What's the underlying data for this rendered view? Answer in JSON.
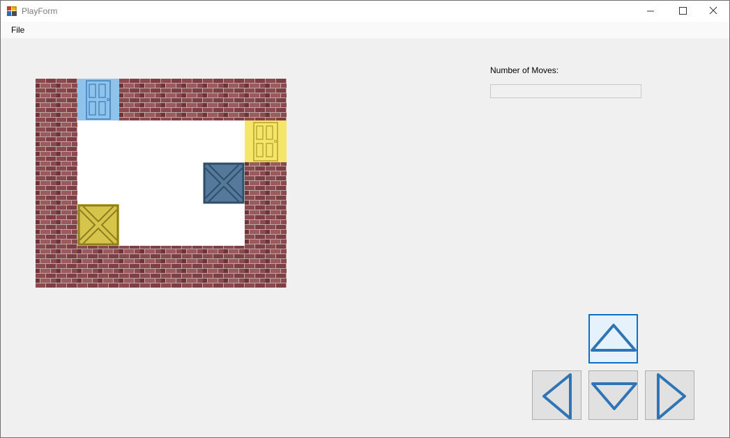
{
  "window": {
    "title": "PlayForm"
  },
  "menu": {
    "file_label": "File"
  },
  "moves": {
    "label": "Number of Moves:",
    "value": ""
  },
  "colors": {
    "brick": "#8b4a4d",
    "mortar": "#bfa9ab",
    "floor": "#ffffff",
    "blue": "#8fc3ec",
    "yellow": "#f5e66a",
    "arrow": "#2f74b5"
  },
  "board": {
    "rows": 5,
    "cols": 6,
    "grid": [
      [
        "wall",
        "door-blue",
        "wall",
        "wall",
        "wall",
        "wall"
      ],
      [
        "wall",
        "floor",
        "floor",
        "floor",
        "floor",
        "door-yellow"
      ],
      [
        "wall",
        "floor",
        "floor",
        "floor",
        "box-blue",
        "wall"
      ],
      [
        "wall",
        "box-yellow",
        "floor",
        "floor",
        "floor",
        "wall"
      ],
      [
        "wall",
        "wall",
        "wall",
        "wall",
        "wall",
        "wall"
      ]
    ]
  },
  "controls": {
    "up": "up-arrow-icon",
    "down": "down-arrow-icon",
    "left": "left-arrow-icon",
    "right": "right-arrow-icon"
  }
}
